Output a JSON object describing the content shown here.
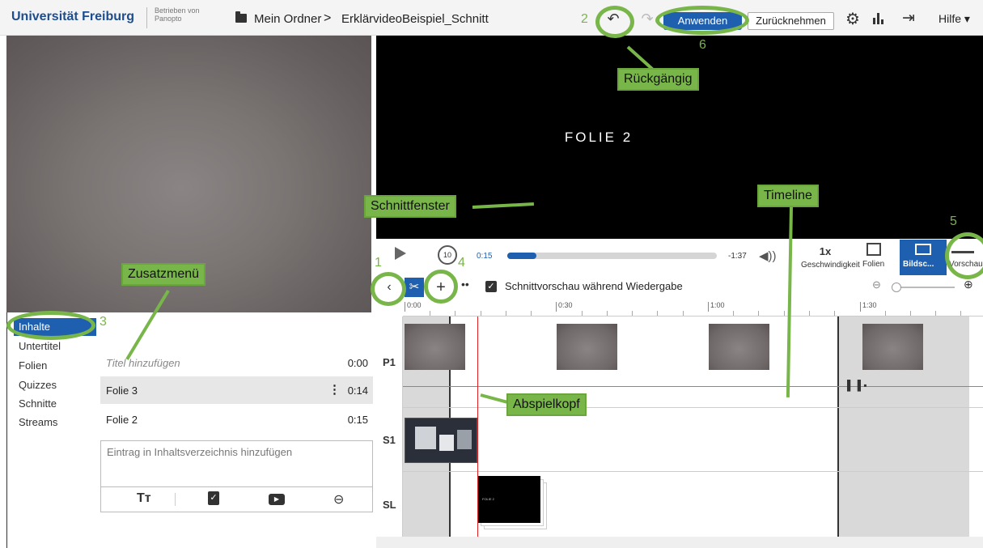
{
  "header": {
    "brand": "Universität Freiburg",
    "powered_by": "Betrieben von Panopto",
    "breadcrumb": {
      "folder": "Mein Ordner",
      "separator": ">",
      "session": "ErklärvideoBeispiel_Schnitt"
    },
    "apply_label": "Anwenden",
    "revert_label": "Zurücknehmen",
    "help_label": "Hilfe ▾",
    "icons": [
      "undo-icon",
      "redo-icon",
      "gear-icon",
      "stats-icon",
      "exit-icon"
    ]
  },
  "side_nav": {
    "items": [
      "Inhalte",
      "Untertitel",
      "Folien",
      "Quizzes",
      "Schnitte",
      "Streams"
    ],
    "active": "Inhalte"
  },
  "contents": {
    "rows": [
      {
        "title": "Titel hinzufügen",
        "time": "0:00"
      },
      {
        "title": "Folie 3",
        "time": "0:14"
      },
      {
        "title": "Folie 2",
        "time": "0:15"
      }
    ],
    "input_placeholder": "Eintrag in Inhaltsverzeichnis hinzufügen",
    "toolbar_icons": [
      "text-format-icon",
      "quiz-icon",
      "youtube-icon",
      "link-icon"
    ]
  },
  "preview": {
    "slide_text": "FOLIE 2"
  },
  "player": {
    "rewind_label": "10",
    "current_time": "0:15",
    "remaining_time": "-1:37",
    "progress": 0.14,
    "speed_value": "1x",
    "speed_label": "Geschwindigkeit",
    "slides_label": "Folien",
    "screen_label": "Bildsc...",
    "preview_label": "Vorschau"
  },
  "timeline": {
    "cut_preview_label": "Schnittvorschau während Wiedergabe",
    "cut_preview_checked": true,
    "ruler_labels": [
      "0:00",
      "0:30",
      "1:00",
      "1:30"
    ],
    "tracks": [
      "P1",
      "S1",
      "SL"
    ],
    "sl_thumb_text": "FOLIE 2"
  },
  "annotations": {
    "labels": {
      "undo": "Rückgängig",
      "edit_window": "Schnittfenster",
      "timeline": "Timeline",
      "extra_menu": "Zusatzmenü",
      "playhead": "Abspielkopf"
    },
    "numbers": {
      "collapse": "1",
      "undo": "2",
      "contents": "3",
      "add": "4",
      "preview": "5",
      "apply": "6"
    }
  },
  "colors": {
    "accent": "#1f5fb0",
    "annotation": "#79b64a",
    "playhead": "#e02020"
  }
}
